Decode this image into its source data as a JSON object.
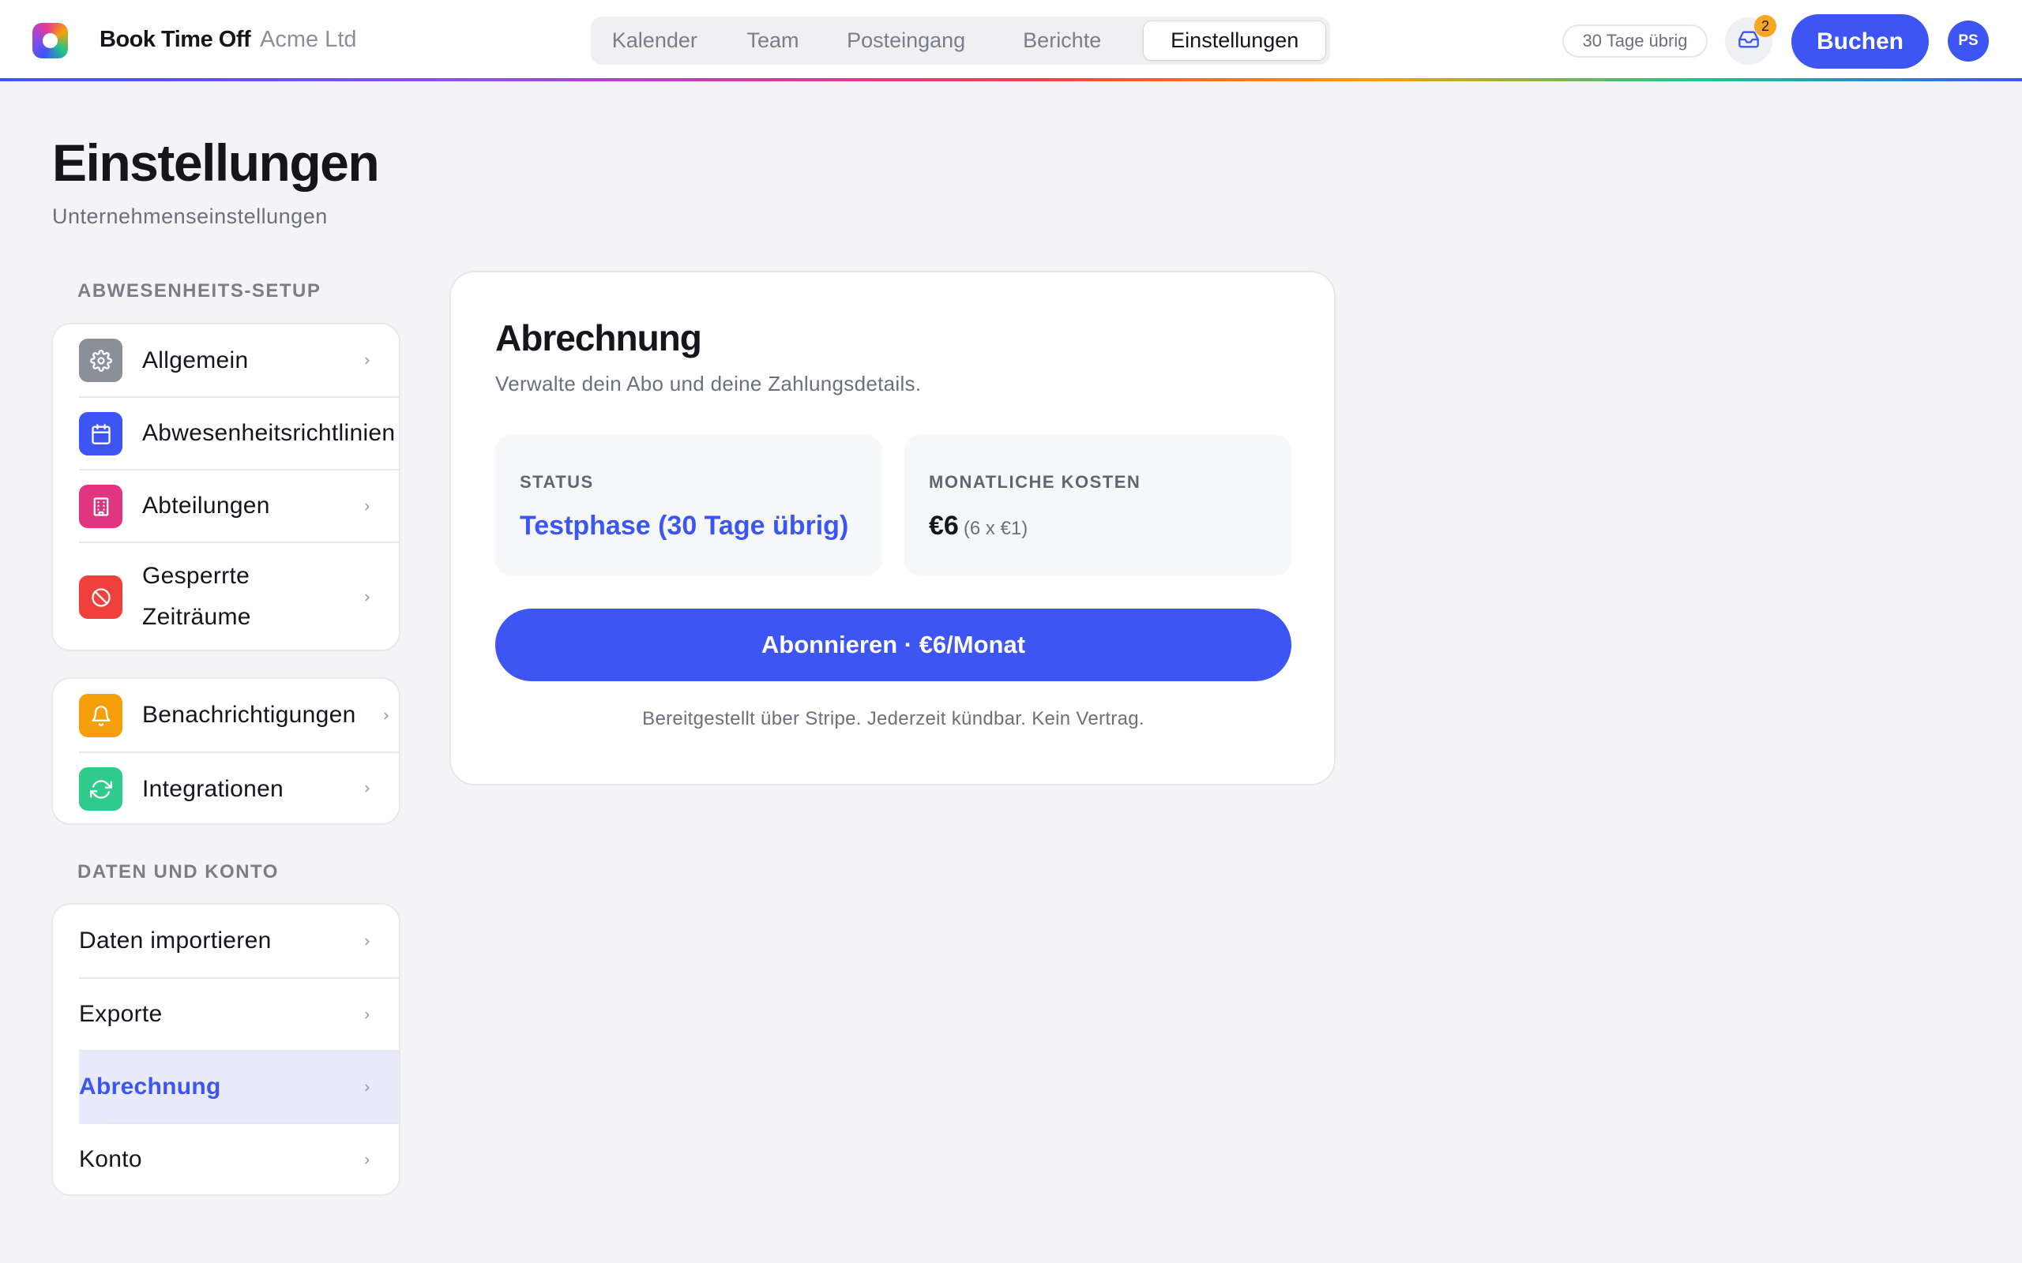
{
  "app": {
    "brand_name": "Book Time Off",
    "company": "Acme Ltd"
  },
  "nav": {
    "tabs": [
      {
        "label": "Kalender"
      },
      {
        "label": "Team"
      },
      {
        "label": "Posteingang"
      },
      {
        "label": "Berichte"
      },
      {
        "label": "Einstellungen",
        "active": true
      }
    ]
  },
  "header": {
    "days_remaining": "30 Tage übrig",
    "inbox_count": "2",
    "book_label": "Buchen",
    "avatar_initials": "PS"
  },
  "page": {
    "title": "Einstellungen",
    "subtitle": "Unternehmenseinstellungen"
  },
  "sidebar": {
    "section_setup": "ABWESENHEITS-SETUP",
    "setup_items": [
      {
        "label": "Allgemein",
        "icon": "gear-icon",
        "color": "#8a8f99"
      },
      {
        "label": "Abwesenheitsrichtlinien",
        "icon": "calendar-icon",
        "color": "#3d55f3"
      },
      {
        "label": "Abteilungen",
        "icon": "building-icon",
        "color": "#e0357f"
      },
      {
        "label": "Gesperrte Zeiträume",
        "icon": "blocked-icon",
        "color": "#f0403c"
      }
    ],
    "comm_items": [
      {
        "label": "Benachrichtigungen",
        "icon": "bell-icon",
        "color": "#f5a00b"
      },
      {
        "label": "Integrationen",
        "icon": "sync-icon",
        "color": "#2ecb8a"
      }
    ],
    "section_data": "DATEN UND KONTO",
    "data_items": [
      {
        "label": "Daten importieren"
      },
      {
        "label": "Exporte"
      },
      {
        "label": "Abrechnung",
        "active": true
      },
      {
        "label": "Konto"
      }
    ]
  },
  "billing": {
    "title": "Abrechnung",
    "subtitle": "Verwalte dein Abo und deine Zahlungsdetails.",
    "status_label": "STATUS",
    "status_value": "Testphase (30 Tage übrig)",
    "cost_label": "MONATLICHE KOSTEN",
    "cost_value": "€6",
    "cost_detail": "(6 x €1)",
    "subscribe_label": "Abonnieren · €6/Monat",
    "footnote": "Bereitgestellt über Stripe. Jederzeit kündbar. Kein Vertrag."
  },
  "colors": {
    "accent": "#3d55f3",
    "active_row_bg": "#e9ebfd",
    "badge": "#f5a623"
  }
}
